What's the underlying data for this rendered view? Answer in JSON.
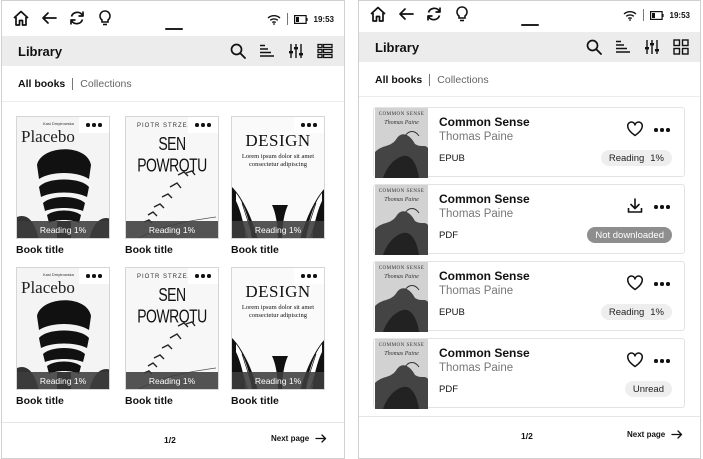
{
  "status_bar": {
    "time": "19:53"
  },
  "header": {
    "title": "Library"
  },
  "tabs": {
    "active": "All books",
    "inactive": "Collections"
  },
  "grid": {
    "cards": [
      {
        "cover": "placebo",
        "cover_title": "Placebo",
        "cover_author": "Kasi Dmytrowska",
        "progress_label": "Reading 1%",
        "title": "Book title"
      },
      {
        "cover": "sen",
        "cover_title": "SEN POWROTU",
        "cover_author": "PIOTR STRZEZYSZ",
        "progress_label": "Reading 1%",
        "title": "Book title"
      },
      {
        "cover": "design",
        "cover_title": "DESIGN",
        "cover_subtitle": "Lorem ipsum dolor sit amet consectetur adipiscing",
        "progress_label": "Reading 1%",
        "title": "Book title"
      },
      {
        "cover": "placebo",
        "cover_title": "Placebo",
        "cover_author": "Kasi Dmytrowska",
        "progress_label": "Reading 1%",
        "title": "Book title"
      },
      {
        "cover": "sen",
        "cover_title": "SEN POWROTU",
        "cover_author": "PIOTR STRZEZYSZ",
        "progress_label": "Reading 1%",
        "title": "Book title"
      },
      {
        "cover": "design",
        "cover_title": "DESIGN",
        "cover_subtitle": "Lorem ipsum dolor sit amet consectetur adipiscing",
        "progress_label": "Reading 1%",
        "title": "Book title"
      }
    ],
    "pager": "1/2",
    "next_label": "Next page"
  },
  "list": {
    "cover_title": "COMMON SENSE",
    "cover_author": "Thomas Paine",
    "rows": [
      {
        "title": "Common Sense",
        "author": "Thomas Paine",
        "format": "EPUB",
        "action_icon": "heart-icon",
        "status_label": "Reading",
        "status_percent": "1%",
        "status_style": "light"
      },
      {
        "title": "Common Sense",
        "author": "Thomas Paine",
        "format": "PDF",
        "action_icon": "download-icon",
        "status_label": "Not downloaded",
        "status_percent": "",
        "status_style": "dark"
      },
      {
        "title": "Common Sense",
        "author": "Thomas Paine",
        "format": "EPUB",
        "action_icon": "heart-icon",
        "status_label": "Reading",
        "status_percent": "1%",
        "status_style": "light"
      },
      {
        "title": "Common Sense",
        "author": "Thomas Paine",
        "format": "PDF",
        "action_icon": "heart-icon",
        "status_label": "Unread",
        "status_percent": "",
        "status_style": "light"
      }
    ],
    "pager": "1/2",
    "next_label": "Next page"
  },
  "colors": {
    "header_bg": "#ececec",
    "progress_bg": "#3c3c3c",
    "pill_bg": "#eeeeee",
    "pill_dark_bg": "#8e8e8e",
    "muted_text": "#777777"
  }
}
